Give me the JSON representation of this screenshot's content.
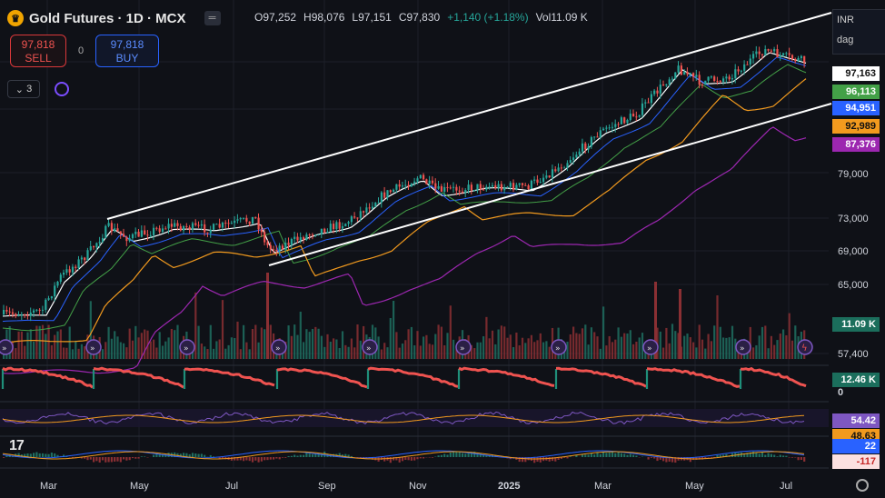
{
  "header": {
    "logo_glyph": "♛",
    "title": "Gold Futures · 1D · MCX",
    "ohlc": {
      "open": "O97,252",
      "high": "H98,076",
      "low": "L97,151",
      "close": "C97,830",
      "change": "+1,140 (+1.18%)",
      "volume": "Vol11.09 K"
    }
  },
  "trade": {
    "sell_price": "97,818",
    "sell_label": "SELL",
    "spread": "0",
    "buy_price": "97,818",
    "buy_label": "BUY"
  },
  "indicators_toggle": {
    "count": "3"
  },
  "currency": {
    "code": "INR",
    "scale": "dag"
  },
  "price_tags": [
    {
      "label": "97,163",
      "bg": "#ffffff",
      "fg": "#111111"
    },
    {
      "label": "96,113",
      "bg": "#43a047",
      "fg": "#ffffff"
    },
    {
      "label": "94,951",
      "bg": "#2962ff",
      "fg": "#ffffff"
    },
    {
      "label": "92,989",
      "bg": "#f29a1e",
      "fg": "#111111"
    },
    {
      "label": "87,376",
      "bg": "#9c27b0",
      "fg": "#ffffff"
    }
  ],
  "y_axis": [
    "79,000",
    "73,000",
    "69,000",
    "65,000",
    "57,400"
  ],
  "volume_tag": {
    "label": "11.09 K",
    "bg": "#1b6e5c"
  },
  "pane_tags": [
    {
      "label": "12.46 K",
      "bg": "#1b6e5c",
      "fg": "#ffffff"
    },
    {
      "label": "0",
      "bg": "transparent",
      "fg": "#d1d4dc"
    },
    {
      "label": "54.42",
      "bg": "#7e57c2",
      "fg": "#ffffff"
    },
    {
      "label": "48.63",
      "bg": "#f29a1e",
      "fg": "#111111"
    },
    {
      "label": "22",
      "bg": "#2962ff",
      "fg": "#ffffff"
    },
    {
      "label": "-117",
      "bg": "#fbe0e0",
      "fg": "#c62828"
    }
  ],
  "x_axis": [
    "Mar",
    "May",
    "Jul",
    "Sep",
    "Nov",
    "2025",
    "Mar",
    "May",
    "Jul"
  ],
  "brand": "17",
  "colors": {
    "up": "#26a69a",
    "down": "#ef5350",
    "bg": "#0f1117"
  }
}
